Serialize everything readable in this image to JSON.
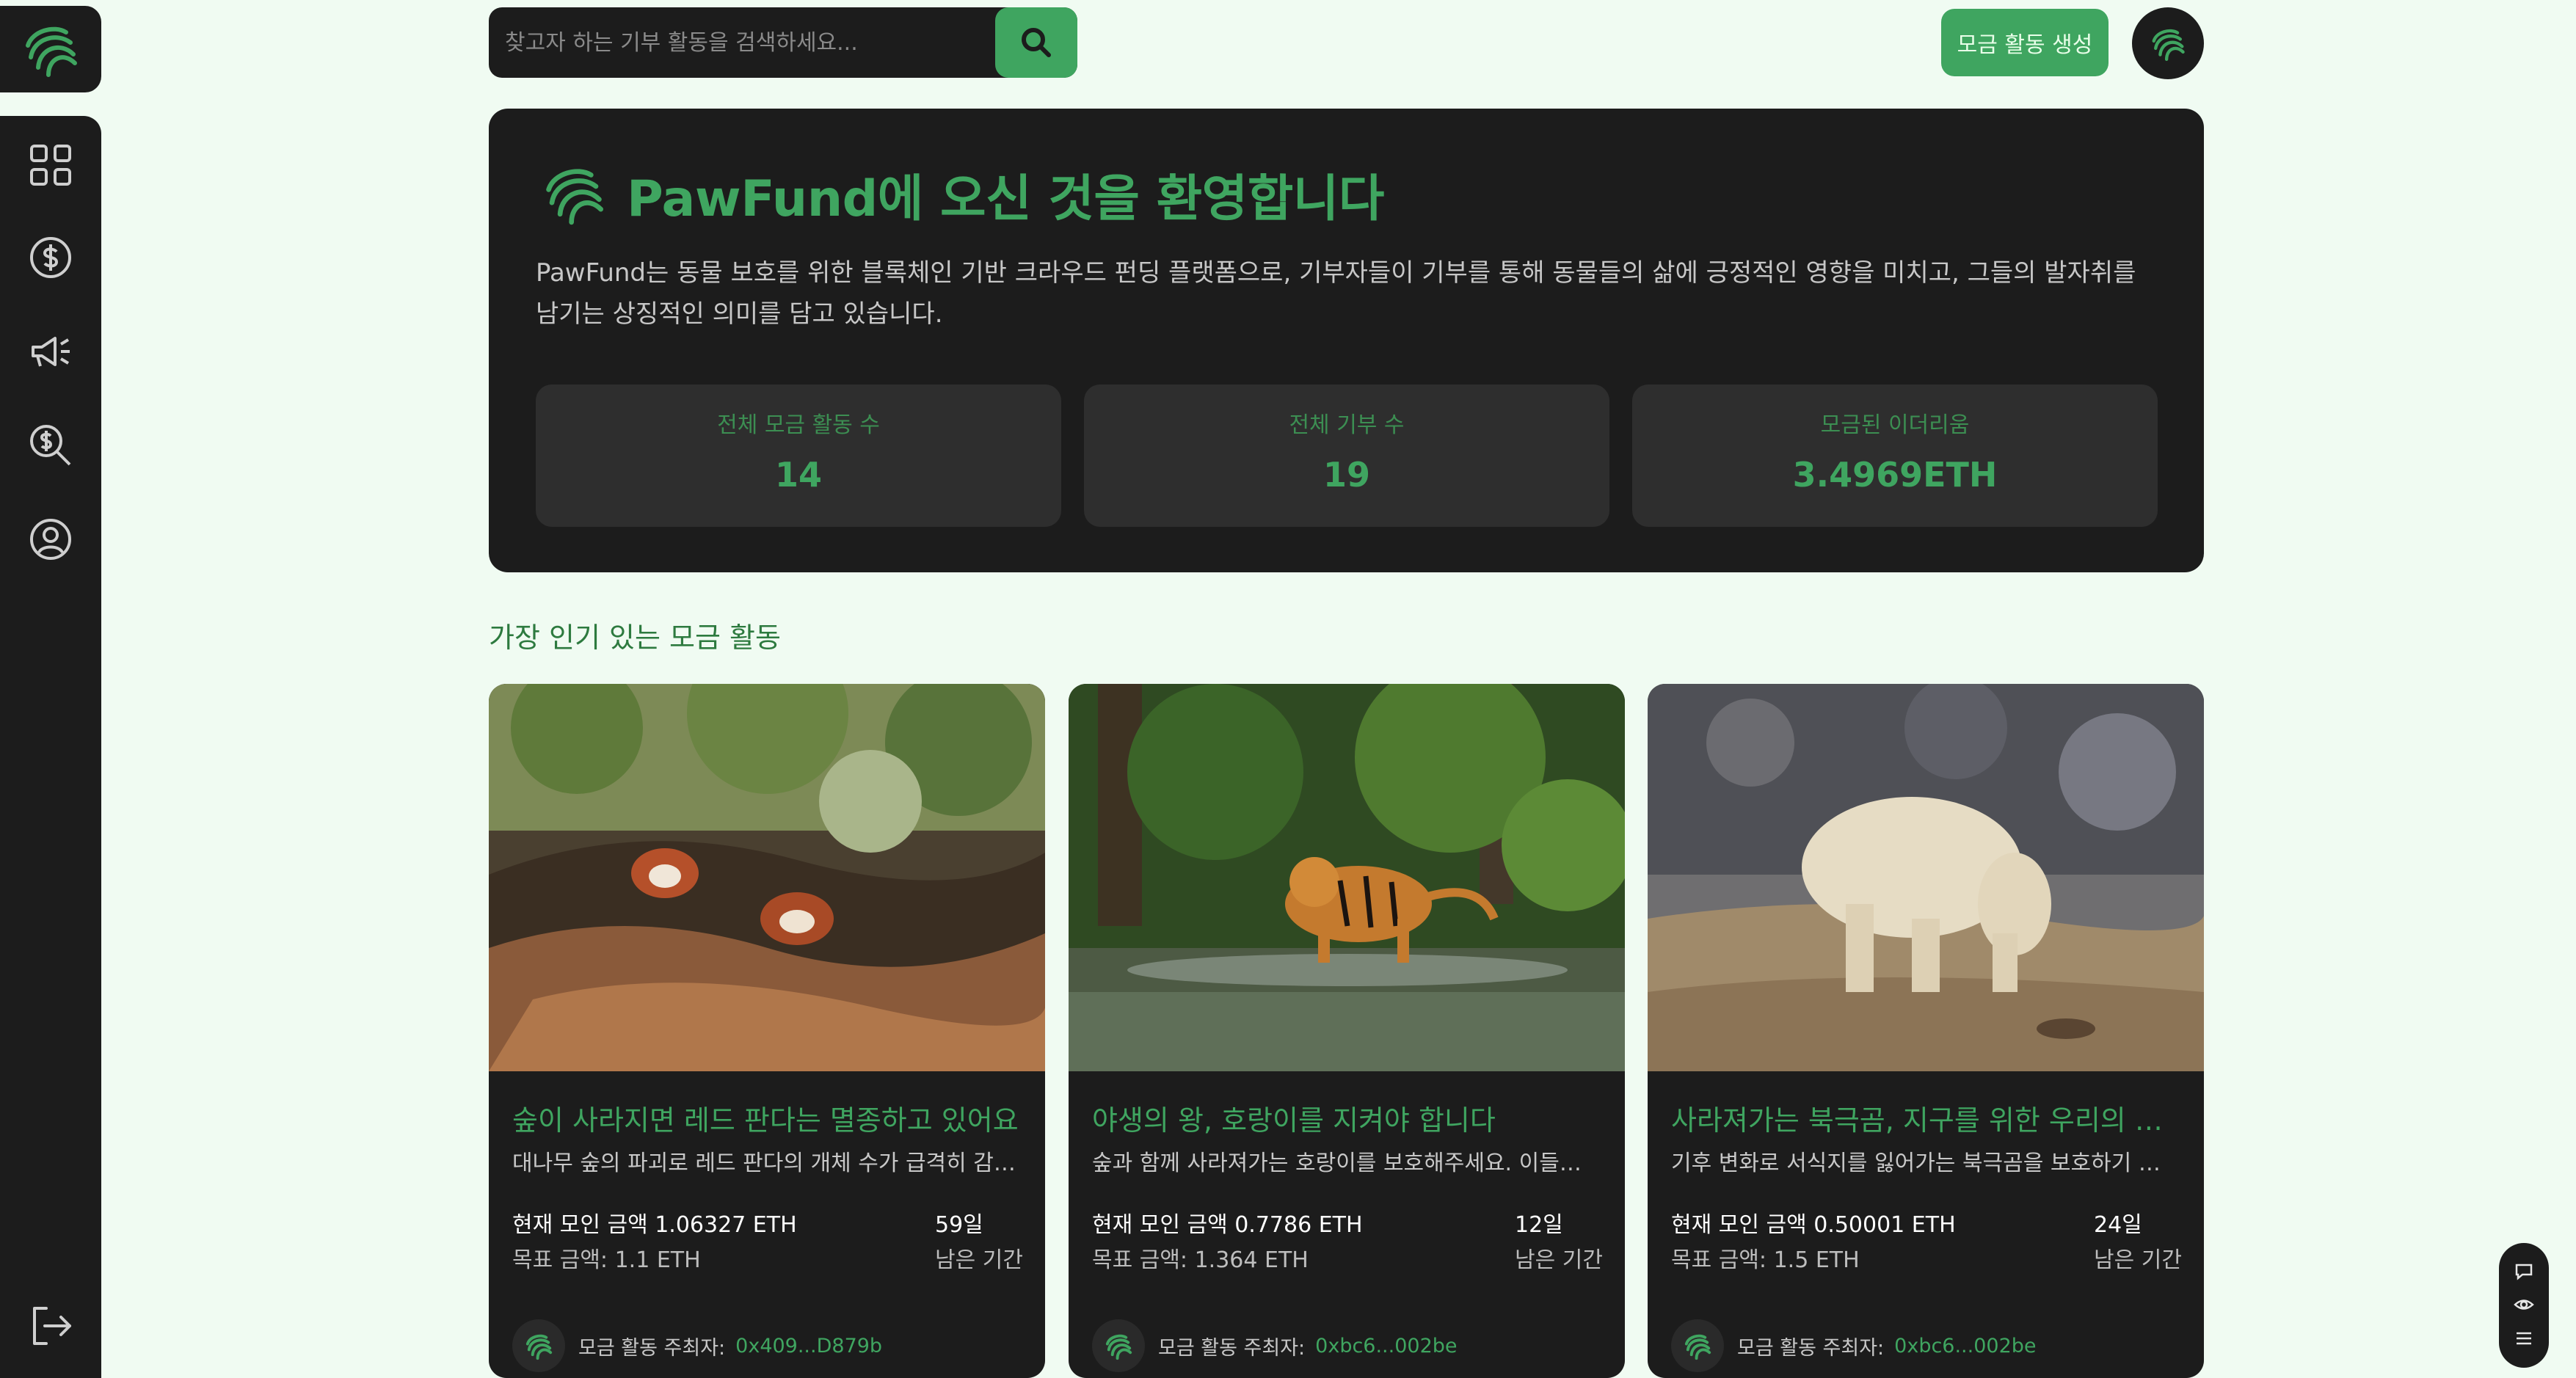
{
  "brand": {
    "logo_icon": "pawfund-paw-logo",
    "accent": "#3fa560",
    "dark": "#1c1c1c",
    "background": "#f0fbf2"
  },
  "sidebar": {
    "items": [
      {
        "icon": "dashboard-grid-icon"
      },
      {
        "icon": "dollar-coin-icon"
      },
      {
        "icon": "megaphone-icon"
      },
      {
        "icon": "search-dollar-icon"
      },
      {
        "icon": "user-profile-icon"
      }
    ],
    "logout_icon": "logout-icon"
  },
  "search": {
    "placeholder": "찾고자 하는 기부 활동을 검색하세요..."
  },
  "header": {
    "create_label": "모금 활동 생성"
  },
  "hero": {
    "title": "PawFund에 오신 것을 환영합니다",
    "description": "PawFund는 동물 보호를 위한 블록체인 기반 크라우드 펀딩 플랫폼으로, 기부자들이 기부를 통해 동물들의 삶에 긍정적인 영향을 미치고, 그들의 발자취를 남기는 상징적인 의미를 담고 있습니다.",
    "stats": [
      {
        "label": "전체 모금 활동 수",
        "value": "14"
      },
      {
        "label": "전체 기부 수",
        "value": "19"
      },
      {
        "label": "모금된 이더리움",
        "value": "3.4969ETH"
      }
    ]
  },
  "popular": {
    "title": "가장 인기 있는 모금 활동",
    "campaigns": [
      {
        "image": "red-pandas-in-tree",
        "title": "숲이 사라지면 레드 판다는 멸종하고 있어요",
        "description": "대나무 숲의 파괴로 레드 판다의 개체 수가 급격히 감소하고 있습니다",
        "raised": "현재 모인 금액 1.06327 ETH",
        "goal": "목표 금액: 1.1 ETH",
        "days": "59일",
        "days_label": "남은 기간",
        "owner_label": "모금 활동 주최자:",
        "owner": "0x409...D879b"
      },
      {
        "image": "tiger-crossing-stream",
        "title": "야생의 왕, 호랑이를 지켜야 합니다",
        "description": "숲과 함께 사라져가는 호랑이를 보호해주세요. 이들이 살아갈 터전을 지켜주세요",
        "raised": "현재 모인 금액 0.7786 ETH",
        "goal": "목표 금액: 1.364 ETH",
        "days": "12일",
        "days_label": "남은 기간",
        "owner_label": "모금 활동 주최자:",
        "owner": "0xbc6...002be"
      },
      {
        "image": "starving-polar-bear",
        "title": "사라져가는 북극곰, 지구를 위한 우리의 약속",
        "description": "기후 변화로 서식지를 잃어가는 북극곰을 보호하기 위해 함께해주세요",
        "raised": "현재 모인 금액 0.50001 ETH",
        "goal": "목표 금액: 1.5 ETH",
        "days": "24일",
        "days_label": "남은 기간",
        "owner_label": "모금 활동 주최자:",
        "owner": "0xbc6...002be"
      }
    ]
  },
  "floating": {
    "icons": [
      "chat-bubble-icon",
      "eye-icon",
      "list-icon"
    ]
  }
}
